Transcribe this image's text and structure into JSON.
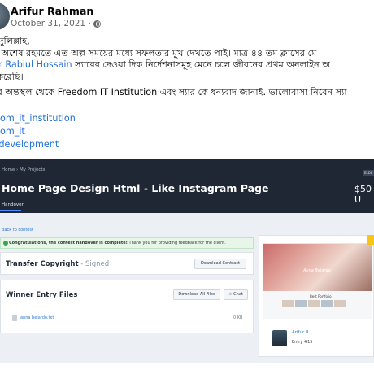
{
  "post": {
    "author": "Arifur Rahman",
    "date": "October 31, 2021 ·",
    "lines": [
      "যমদুলিল্লাহ,",
      "হর অশেষ রহমতে এত অল্প সময়ের মধ্যে সফলতার মুখ দেখতে পাই। মাত্র ৪৪ তম ক্লাসের মে",
      "Rtr Rabiul Hossain",
      " স্যারের দেওয়া দিক নির্দেশনাসমূহ মেনে চলে জীবনের প্রথম অনলাইন অ",
      "র্ন করেছি।",
      "রের অন্তস্থল থেকে Freedom IT Institution এবং স্যার কে ধন্যবাদ জানাই. ভালোবাসা নিবেন স্যা"
    ],
    "hashtags": [
      "edom_it_institution",
      "edom_it",
      "o_development"
    ]
  },
  "screenshot": {
    "breadcrumb": "Home  ›  My Projects",
    "project_title": "Home Page Design Html - Like Instagram Page",
    "price": "$50 U",
    "price_badge": "ELDE",
    "tab": "Handover",
    "back_link": "Back to contest",
    "alert_bold": "Congratulations, the contest handover is complete!",
    "alert_rest": " Thank you for providing feedback for the client.",
    "transfer_title": "Transfer Copyright",
    "transfer_status": " - Signed",
    "download_contract": "Download Contract",
    "winner_files_title": "Winner Entry Files",
    "download_all": "Download All Files",
    "chat": "☆ Chat",
    "file_name": "anna belardo.txt",
    "file_size": "0 KB",
    "preview_hero_text": "Anna Belardo",
    "preview_sub": "Best Portfolio",
    "winner_name": "Arifur R.",
    "winner_entry": "Entry #15"
  },
  "colors": {
    "link": "#216fdb",
    "banner": "#1e2733",
    "alert_bg": "#e8f6ea"
  }
}
